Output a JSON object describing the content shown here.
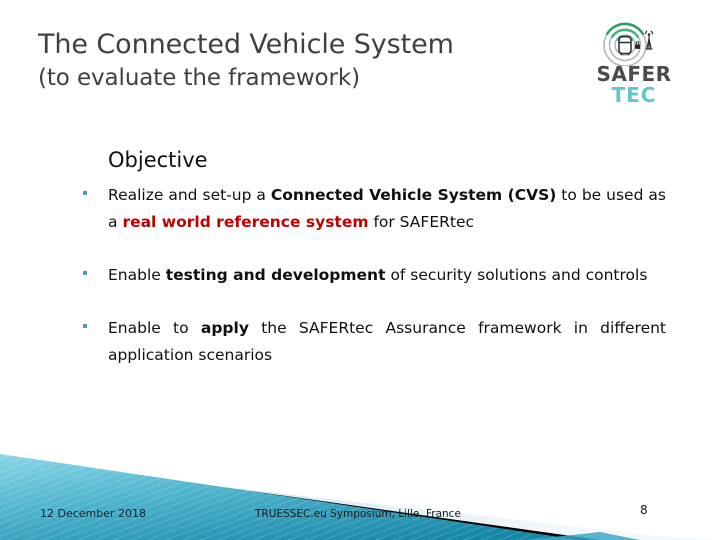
{
  "slide": {
    "title_line1": "The Connected Vehicle System",
    "title_line2": "(to evaluate the framework)",
    "heading": "Objective"
  },
  "logo": {
    "name": "safertec-logo",
    "word_safer": "SAFER",
    "word_tec": "TEC",
    "icon_names": [
      "car-icon",
      "wifi-arcs-icon",
      "lock-icon",
      "antenna-tower-icon"
    ],
    "colors": {
      "safer_text": "#4a4a4a",
      "tec_text": "#63c5cd",
      "arc_green": "#35a36a",
      "arc_teal": "#4fb8a8",
      "arc_gray": "#9aa0a3",
      "car_dark": "#2b2b2b"
    }
  },
  "bullets": [
    {
      "id": "bullet-1",
      "segments": [
        {
          "text": "Realize and set-up a ",
          "style": "normal"
        },
        {
          "text": "Connected Vehicle System (CVS)",
          "style": "bold"
        },
        {
          "text": " to be used as a ",
          "style": "normal"
        },
        {
          "text": "real world reference system",
          "style": "red-bold"
        },
        {
          "text": " for SAFERtec",
          "style": "normal"
        }
      ]
    },
    {
      "id": "bullet-2",
      "segments": [
        {
          "text": "Enable ",
          "style": "normal"
        },
        {
          "text": "testing and development",
          "style": "bold"
        },
        {
          "text": " of security solutions and controls",
          "style": "normal"
        }
      ]
    },
    {
      "id": "bullet-3",
      "segments": [
        {
          "text": "Enable to ",
          "style": "normal"
        },
        {
          "text": "apply",
          "style": "bold"
        },
        {
          "text": " the SAFERtec Assurance framework in different application scenarios",
          "style": "normal"
        }
      ]
    }
  ],
  "footer": {
    "date": "12 December 2018",
    "event": "TRUESSEC.eu Symposium, Lille, France",
    "page_number": "8",
    "colors": {
      "teal_light": "#79cfe0",
      "teal_dark": "#1a8aa8",
      "black_band": "#000000",
      "pale_blue": "#dbe7ec"
    }
  },
  "theme": {
    "title_color": "#404040",
    "body_color": "#101010",
    "accent_red": "#c00000",
    "bullet_marker": "#4f9ab8",
    "background": "#ffffff"
  }
}
